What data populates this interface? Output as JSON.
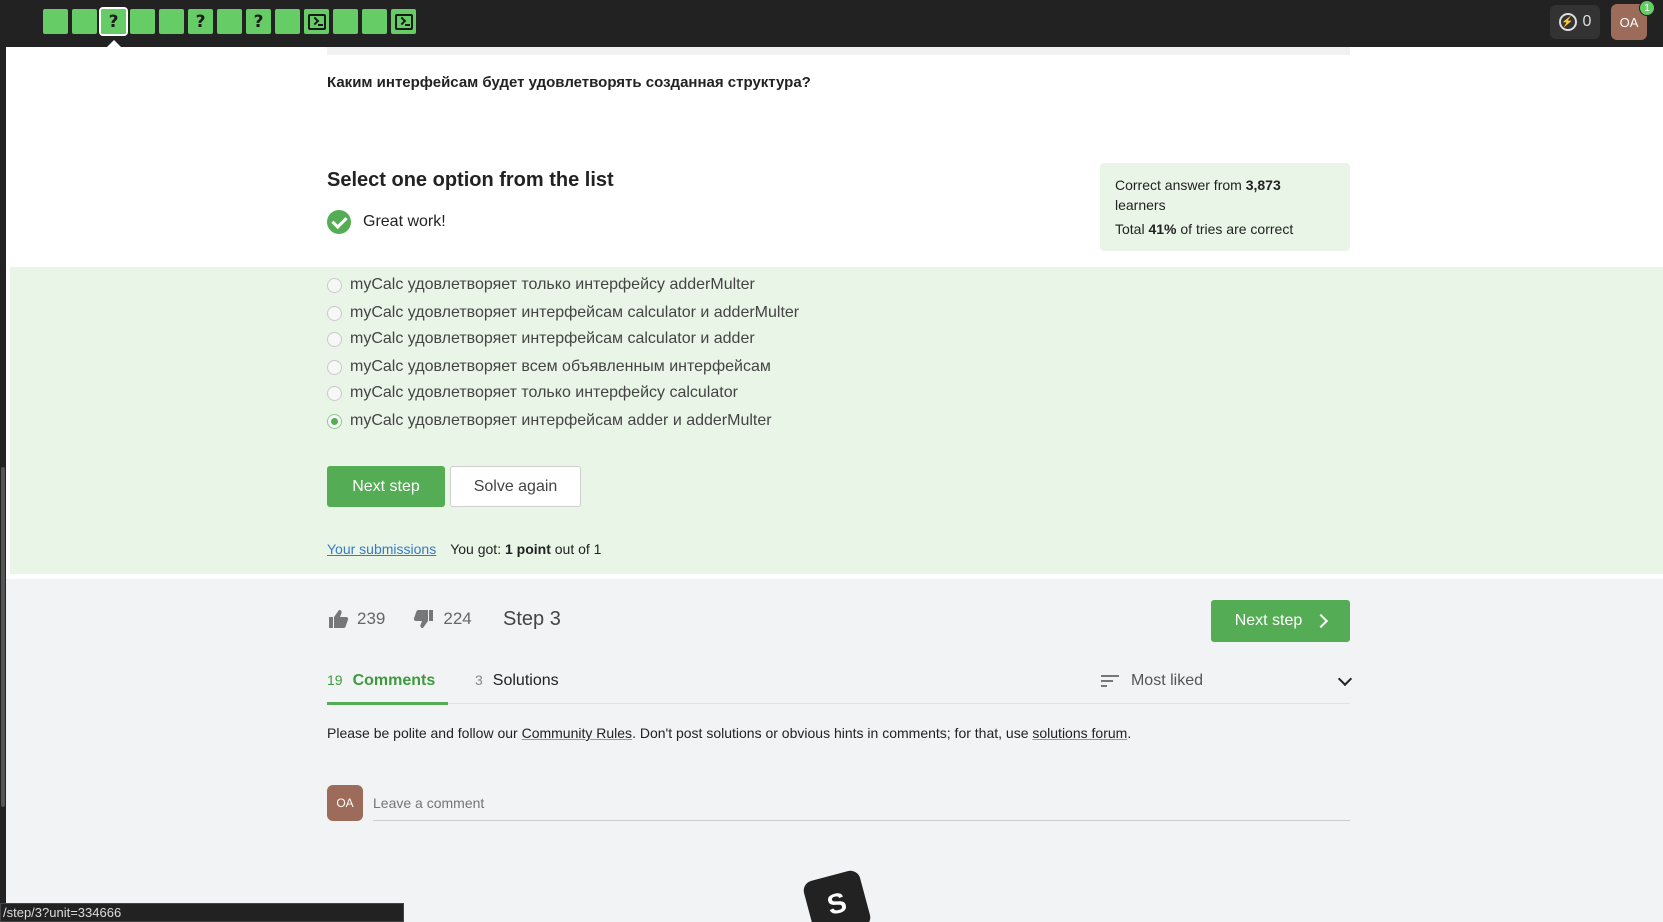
{
  "steps": [
    {
      "type": "blank"
    },
    {
      "type": "blank"
    },
    {
      "type": "question",
      "current": true
    },
    {
      "type": "blank"
    },
    {
      "type": "blank"
    },
    {
      "type": "question"
    },
    {
      "type": "blank"
    },
    {
      "type": "question"
    },
    {
      "type": "blank"
    },
    {
      "type": "terminal"
    },
    {
      "type": "blank"
    },
    {
      "type": "blank"
    },
    {
      "type": "terminal"
    }
  ],
  "header": {
    "energy": "0",
    "avatar_initials": "OA",
    "notifications": "1"
  },
  "question_text": "Каким интерфейсам будет удовлетворять созданная структура?",
  "select_title": "Select one option from the list",
  "feedback": "Great work!",
  "stats": {
    "line1_prefix": "Correct answer from ",
    "learners_count": "3,873",
    "line1_suffix": " learners",
    "line2_prefix": "Total ",
    "percent": "41%",
    "line2_suffix": " of tries are correct"
  },
  "options": [
    {
      "label": "myCalc удовлетворяет только интерфейсу adderMulter",
      "selected": false
    },
    {
      "label": "myCalc удовлетворяет интерфейсам calculator и adderMulter",
      "selected": false
    },
    {
      "label": "myCalc удовлетворяет интерфейсам calculator и adder",
      "selected": false
    },
    {
      "label": "myCalc удовлетворяет всем объявленным интерфейсам",
      "selected": false
    },
    {
      "label": "myCalc удовлетворяет только интерфейсу calculator",
      "selected": false
    },
    {
      "label": "myCalc удовлетворяет интерфейсам adder и adderMulter",
      "selected": true
    }
  ],
  "buttons": {
    "next_step": "Next step",
    "solve_again": "Solve again"
  },
  "submissions": {
    "link": "Your submissions",
    "got_prefix": "You got: ",
    "points": "1 point",
    "got_suffix": " out of 1"
  },
  "footer": {
    "likes": "239",
    "dislikes": "224",
    "step_label": "Step 3",
    "next_step": "Next step"
  },
  "tabs": [
    {
      "count": "19",
      "label": "Comments",
      "active": true
    },
    {
      "count": "3",
      "label": "Solutions",
      "active": false
    }
  ],
  "sort": {
    "label": "Most liked"
  },
  "rules": {
    "prefix": "Please be polite and follow our ",
    "community_rules": "Community Rules",
    "middle": ". Don't post solutions or obvious hints in comments; for that, use ",
    "forum": "solutions forum",
    "suffix": "."
  },
  "comment": {
    "avatar_initials": "OA",
    "placeholder": "Leave a comment"
  },
  "status_url": "/step/3?unit=334666",
  "colors": {
    "accent": "#54ad54",
    "panel": "#e9f6e7",
    "topbar": "#222222"
  }
}
